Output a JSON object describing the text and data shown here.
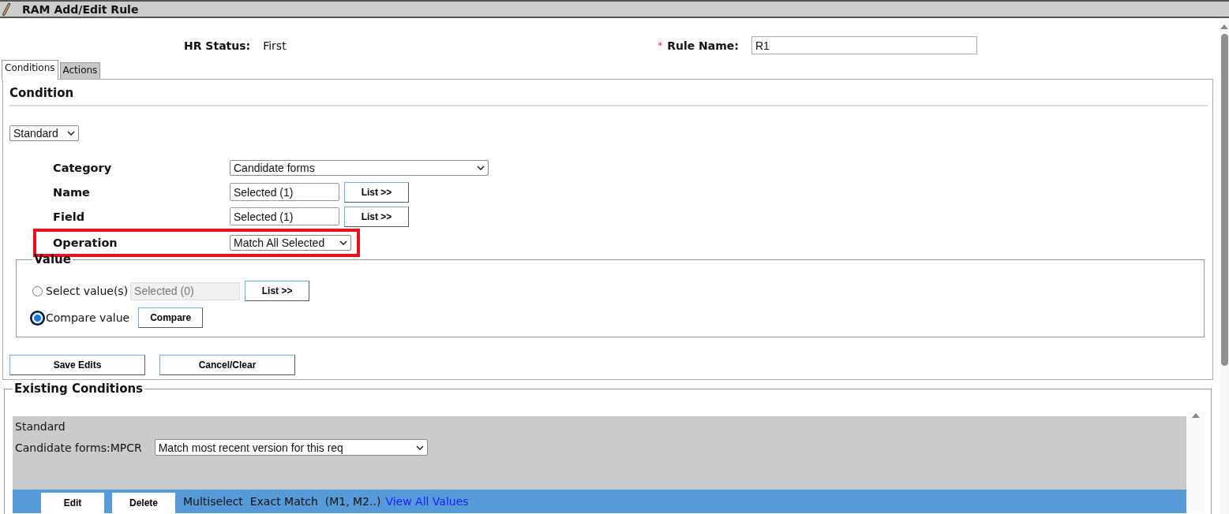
{
  "window": {
    "title": "RAM Add/Edit Rule"
  },
  "header": {
    "hr_status_label": "HR Status:",
    "hr_status_value": "First",
    "required_mark": "*",
    "rule_name_label": "Rule Name:",
    "rule_name_value": "R1"
  },
  "tabs": [
    {
      "label": "Conditions",
      "selected": true
    },
    {
      "label": "Actions",
      "selected": false
    }
  ],
  "condition": {
    "title": "Condition",
    "type_select": "Standard",
    "rows": [
      {
        "kind": "select",
        "label": "Category",
        "value": "Candidate forms",
        "highlighted": false
      },
      {
        "kind": "list",
        "label": "Name",
        "value": "Selected (1)",
        "button": "List >>",
        "highlighted": false
      },
      {
        "kind": "list",
        "label": "Field",
        "value": "Selected (1)",
        "button": "List >>",
        "highlighted": false
      },
      {
        "kind": "select",
        "label": "Operation",
        "value": "Match All Selected",
        "highlighted": true
      }
    ],
    "value_group": {
      "legend": "Value",
      "options": [
        {
          "kind": "list",
          "label": "Select value(s)",
          "selected": false,
          "field": "Selected (0)",
          "disabled": true,
          "button": "List >>"
        },
        {
          "kind": "compare",
          "label": "Compare value",
          "selected": true,
          "button": "Compare"
        }
      ]
    },
    "buttons": [
      "Save Edits",
      "Cancel/Clear"
    ]
  },
  "existing": {
    "legend": "Existing Conditions",
    "groups": [
      {
        "type": "Standard",
        "label": "Candidate forms:MPCR",
        "select": "Match most recent version for this req",
        "rows": [
          {
            "edit": "Edit",
            "delete": "Delete",
            "description": "Multiselect  Exact Match  (M1, M2..)",
            "link": "View All Values"
          }
        ]
      }
    ]
  }
}
